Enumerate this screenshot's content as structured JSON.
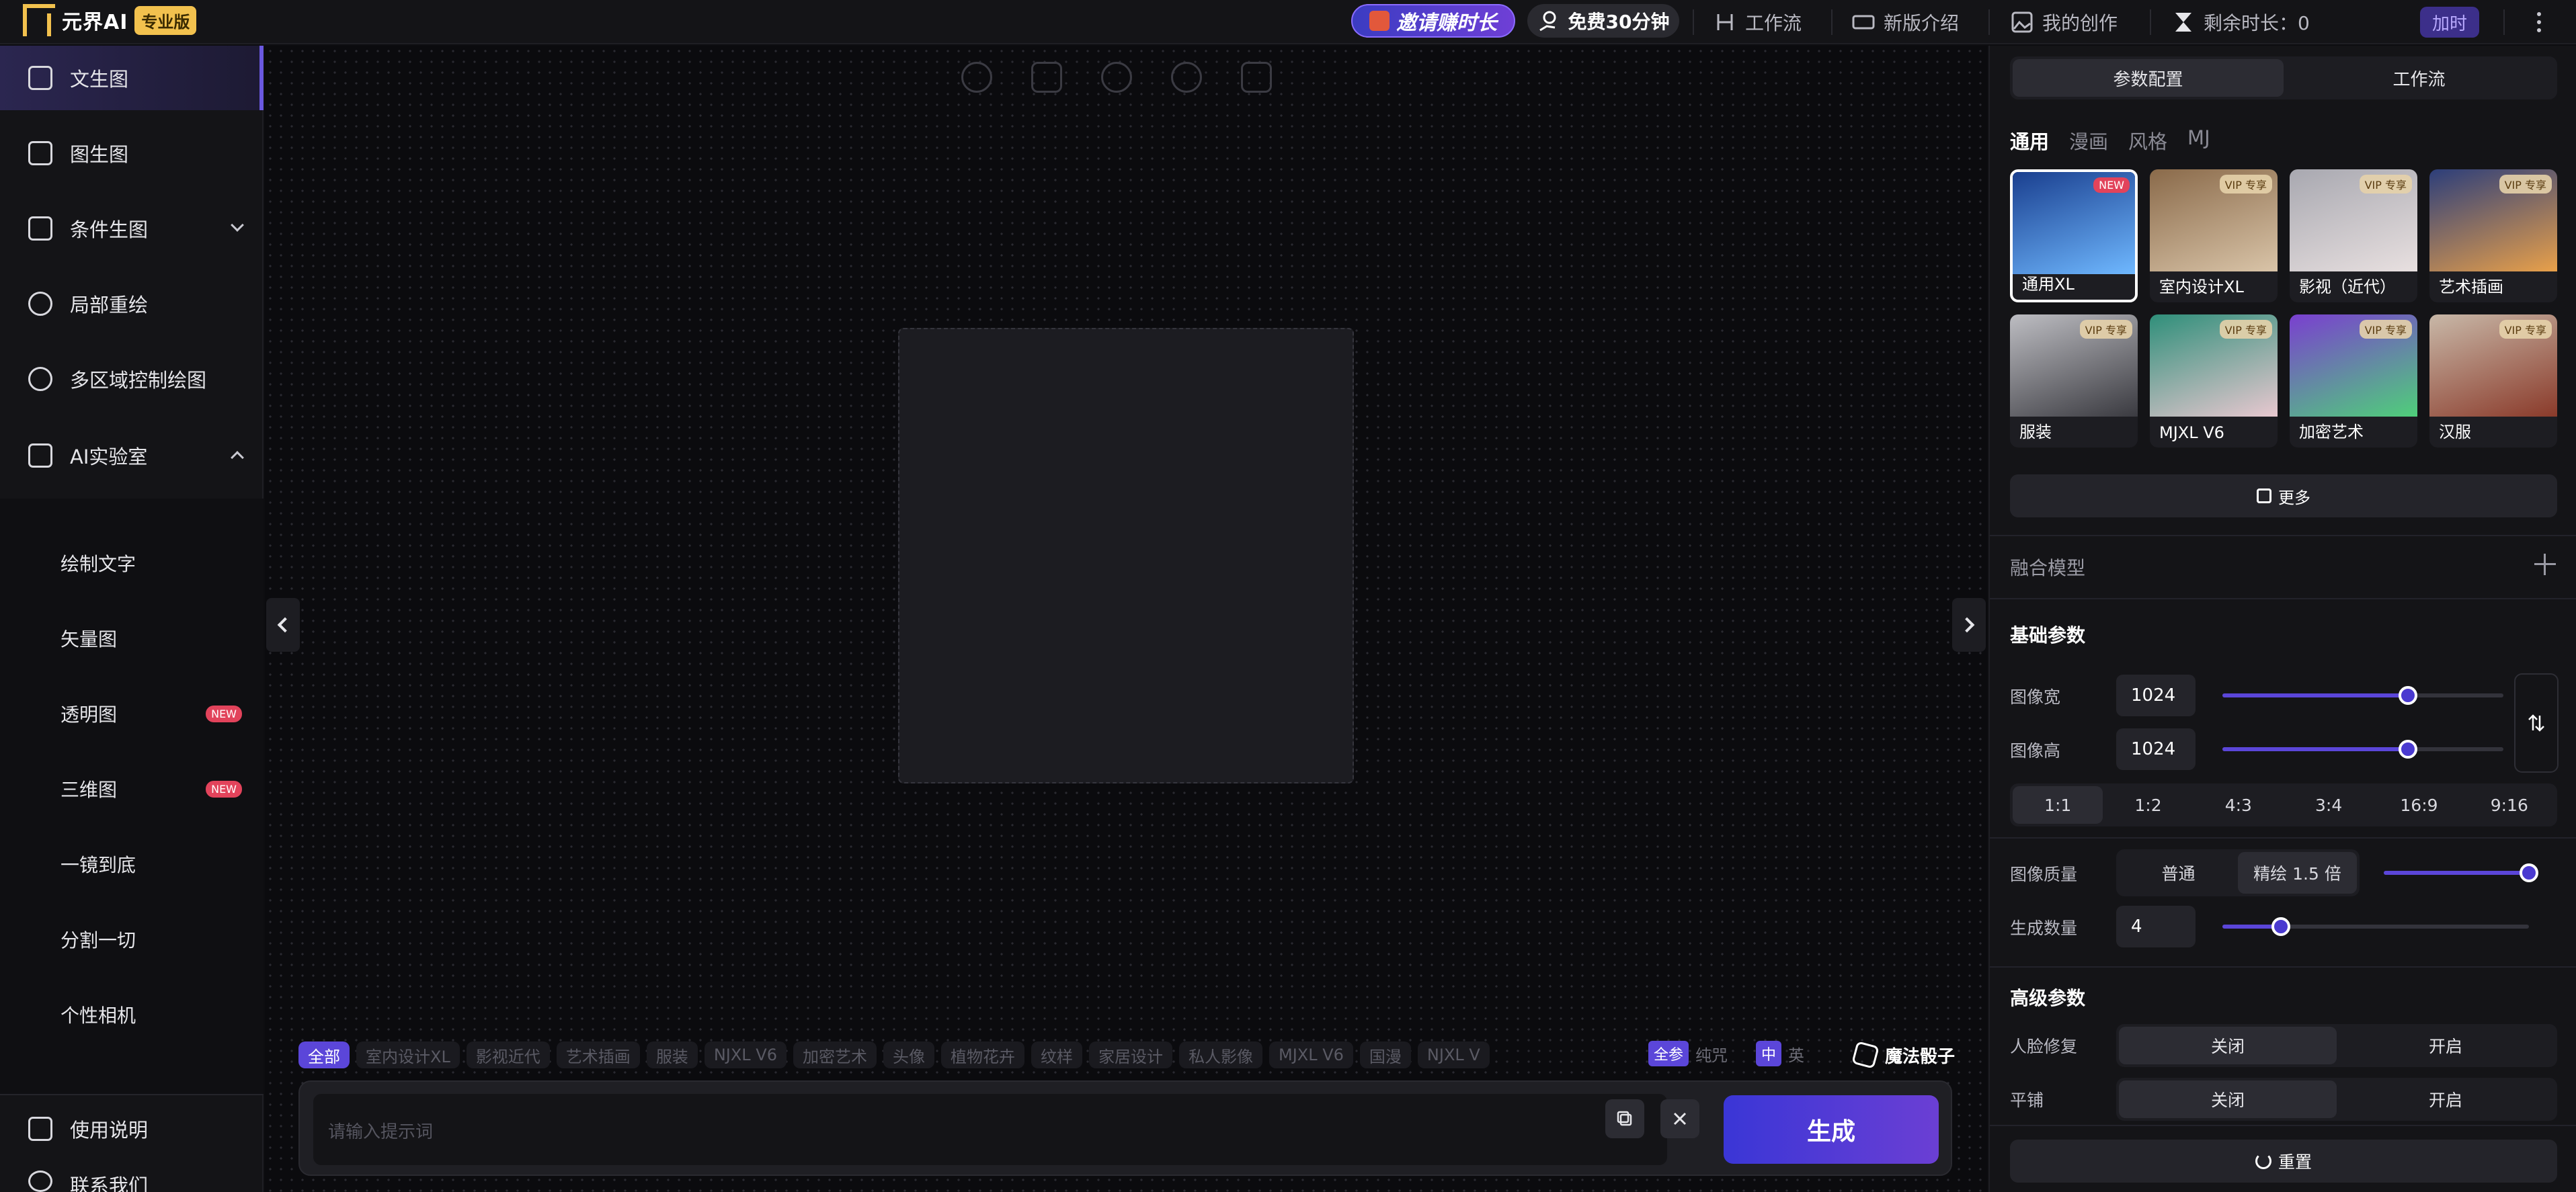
{
  "header": {
    "logo_text": "元界AI",
    "logo_badge": "专业版",
    "invite_label": "邀请赚时长",
    "free_label": "免费30分钟",
    "workflow_label": "工作流",
    "new_intro_label": "新版介绍",
    "my_creation_label": "我的创作",
    "remaining_label": "剩余时长：0",
    "add_time_label": "加时"
  },
  "sidebar": {
    "items": [
      {
        "label": "文生图",
        "icon": "image-icon"
      },
      {
        "label": "图生图",
        "icon": "images-icon"
      },
      {
        "label": "条件生图",
        "icon": "frame-icon"
      },
      {
        "label": "局部重绘",
        "icon": "brush-icon"
      },
      {
        "label": "多区域控制绘图",
        "icon": "regions-icon"
      },
      {
        "label": "AI实验室",
        "icon": "flask-icon"
      }
    ],
    "lab_items": [
      {
        "label": "绘制文字",
        "badge": ""
      },
      {
        "label": "矢量图",
        "badge": ""
      },
      {
        "label": "透明图",
        "badge": "NEW"
      },
      {
        "label": "三维图",
        "badge": "NEW"
      },
      {
        "label": "一镜到底",
        "badge": ""
      },
      {
        "label": "分割一切",
        "badge": ""
      },
      {
        "label": "个性相机",
        "badge": ""
      }
    ],
    "footer": [
      {
        "label": "使用说明",
        "icon": "book-icon"
      },
      {
        "label": "联系我们",
        "icon": "headset-icon"
      }
    ]
  },
  "canvas": {
    "tags": [
      "全部",
      "室内设计XL",
      "影视近代",
      "艺术插画",
      "服装",
      "NJXL V6",
      "加密艺术",
      "头像",
      "植物花卉",
      "纹样",
      "家居设计",
      "私人影像",
      "MJXL V6",
      "国漫",
      "NJXL V"
    ],
    "opt_all": "全参",
    "opt_pure": "纯咒",
    "opt_zh": "中",
    "opt_en": "英",
    "dice_label": "魔法骰子",
    "prompt_placeholder": "请输入提示词",
    "generate_label": "生成"
  },
  "panel": {
    "seg_params": "参数配置",
    "seg_workflow": "工作流",
    "tabs": [
      "通用",
      "漫画",
      "风格",
      "MJ"
    ],
    "models": [
      {
        "name": "通用XL",
        "badge": "NEW",
        "color1": "#1a3f8f",
        "color2": "#6fb8ff"
      },
      {
        "name": "室内设计XL",
        "badge": "VIP 专享",
        "color1": "#8a6a4a",
        "color2": "#d9c4a8"
      },
      {
        "name": "影视（近代）",
        "badge": "VIP 专享",
        "color1": "#a8a8b0",
        "color2": "#e8e0e0"
      },
      {
        "name": "艺术插画",
        "badge": "VIP 专享",
        "color1": "#2c3e7a",
        "color2": "#e8a04a"
      },
      {
        "name": "服装",
        "badge": "VIP 专享",
        "color1": "#bdbdc2",
        "color2": "#3a3a40"
      },
      {
        "name": "MJXL V6",
        "badge": "VIP 专享",
        "color1": "#2f8f7a",
        "color2": "#e8c8d0"
      },
      {
        "name": "加密艺术",
        "badge": "VIP 专享",
        "color1": "#7a3fd0",
        "color2": "#4fcf7a"
      },
      {
        "name": "汉服",
        "badge": "VIP 专享",
        "color1": "#c8b8a8",
        "color2": "#8a3a2a"
      }
    ],
    "more_label": "更多",
    "fusion_label": "融合模型",
    "basic_label": "基础参数",
    "width_label": "图像宽",
    "width_value": "1024",
    "height_label": "图像高",
    "height_value": "1024",
    "ratios": [
      "1:1",
      "1:2",
      "4:3",
      "3:4",
      "16:9",
      "9:16"
    ],
    "quality_label": "图像质量",
    "quality_normal": "普通",
    "quality_fine": "精绘 1.5 倍",
    "count_label": "生成数量",
    "count_value": "4",
    "advanced_label": "高级参数",
    "face_label": "人脸修复",
    "tile_label": "平铺",
    "off_label": "关闭",
    "on_label": "开启",
    "reset_label": "重置",
    "slider_width_fraction": 0.66,
    "slider_height_fraction": 0.66,
    "slider_quality_fraction": 1.0,
    "slider_count_fraction": 0.19
  }
}
